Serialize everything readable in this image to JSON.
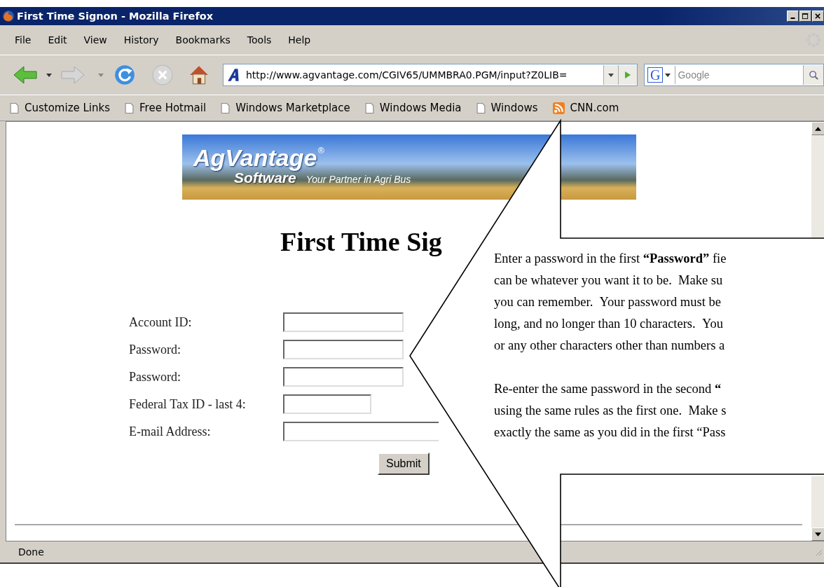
{
  "window": {
    "title": "First Time Signon - Mozilla Firefox"
  },
  "menu": [
    "File",
    "Edit",
    "View",
    "History",
    "Bookmarks",
    "Tools",
    "Help"
  ],
  "toolbar": {
    "url": "http://www.agvantage.com/CGIV65/UMMBRA0.PGM/input?Z0LIB=",
    "search_engine": "G",
    "search_placeholder": "Google"
  },
  "bookmarks": [
    {
      "label": "Customize Links",
      "kind": "page"
    },
    {
      "label": "Free Hotmail",
      "kind": "page"
    },
    {
      "label": "Windows Marketplace",
      "kind": "page"
    },
    {
      "label": "Windows Media",
      "kind": "page"
    },
    {
      "label": "Windows",
      "kind": "page"
    },
    {
      "label": "CNN.com",
      "kind": "feed"
    }
  ],
  "page": {
    "banner": {
      "brand": "AgVantage",
      "mark": "®",
      "subbrand": "Software",
      "tagline": "Your Partner in Agri Bus"
    },
    "heading": "First Time Sig",
    "fields": [
      {
        "label": "Account ID:",
        "kind": "normal"
      },
      {
        "label": "Password:",
        "kind": "normal"
      },
      {
        "label": "Password:",
        "kind": "normal"
      },
      {
        "label": "Federal Tax ID - last 4:",
        "kind": "short"
      },
      {
        "label": "E-mail Address:",
        "kind": "wide"
      }
    ],
    "submit": "Submit"
  },
  "status_bar": {
    "text": "Done"
  },
  "callout": {
    "paragraphs": [
      [
        "Enter a password in the first **“Password”** fie",
        "can be whatever you want it to be.  Make su",
        "you can remember.  Your password must be",
        "long, and no longer than 10 characters.  You",
        "or any other characters other than numbers a"
      ],
      [
        "Re-enter the same password in the second **“**",
        "using the same rules as the first one.  Make s",
        "exactly the same as you did in the first “Pass"
      ]
    ]
  }
}
